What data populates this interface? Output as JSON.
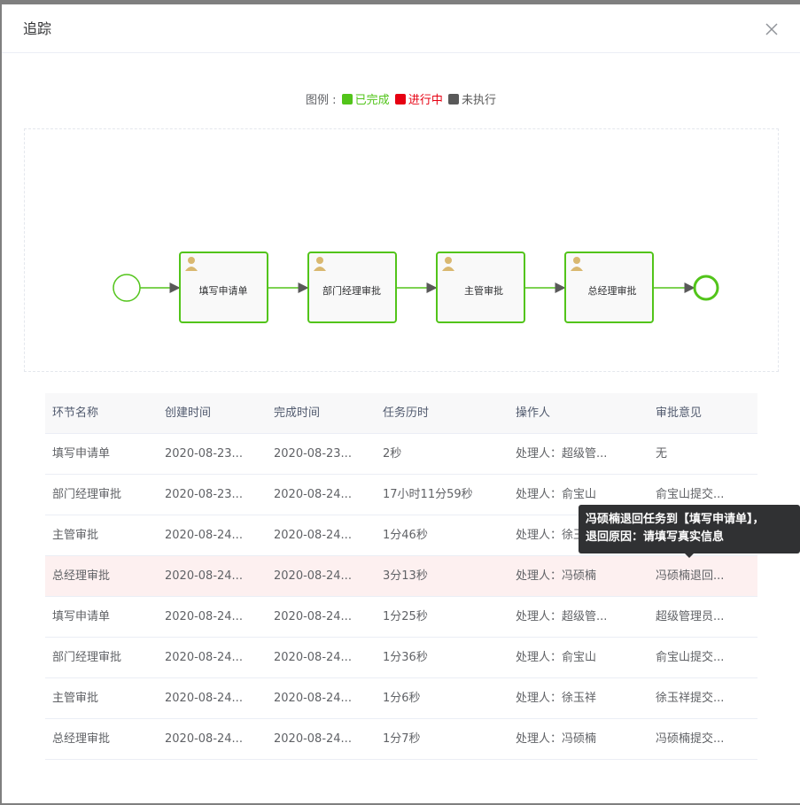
{
  "dialog": {
    "title": "追踪"
  },
  "legend": {
    "prefix": "图例 :",
    "items": [
      {
        "label": "已完成",
        "color": "#52c41a"
      },
      {
        "label": "进行中",
        "color": "#e60012"
      },
      {
        "label": "未执行",
        "color": "#595959"
      }
    ]
  },
  "diagram": {
    "nodes": [
      {
        "label": "填写申请单",
        "status": "completed"
      },
      {
        "label": "部门经理审批",
        "status": "completed"
      },
      {
        "label": "主管审批",
        "status": "completed"
      },
      {
        "label": "总经理审批",
        "status": "completed"
      }
    ],
    "completed_color": "#52c41a"
  },
  "table": {
    "headers": [
      "环节名称",
      "创建时间",
      "完成时间",
      "任务历时",
      "操作人",
      "审批意见"
    ],
    "rows": [
      [
        "填写申请单",
        "2020-08-23...",
        "2020-08-23...",
        "2秒",
        "处理人：超级管...",
        "无"
      ],
      [
        "部门经理审批",
        "2020-08-23...",
        "2020-08-24...",
        "17小时11分59秒",
        "处理人：俞宝山",
        "俞宝山提交..."
      ],
      [
        "主管审批",
        "2020-08-24...",
        "2020-08-24...",
        "1分46秒",
        "处理人：徐玉祥",
        ""
      ],
      [
        "总经理审批",
        "2020-08-24...",
        "2020-08-24...",
        "3分13秒",
        "处理人：冯硕楠",
        "冯硕楠退回..."
      ],
      [
        "填写申请单",
        "2020-08-24...",
        "2020-08-24...",
        "1分25秒",
        "处理人：超级管...",
        "超级管理员..."
      ],
      [
        "部门经理审批",
        "2020-08-24...",
        "2020-08-24...",
        "1分36秒",
        "处理人：俞宝山",
        "俞宝山提交..."
      ],
      [
        "主管审批",
        "2020-08-24...",
        "2020-08-24...",
        "1分6秒",
        "处理人：徐玉祥",
        "徐玉祥提交..."
      ],
      [
        "总经理审批",
        "2020-08-24...",
        "2020-08-24...",
        "1分7秒",
        "处理人：冯硕楠",
        "冯硕楠提交..."
      ]
    ],
    "highlight_row": 3
  },
  "tooltip": {
    "line1": "冯硕楠退回任务到【填写申请单】，",
    "line2": "退回原因：请填写真实信息"
  }
}
